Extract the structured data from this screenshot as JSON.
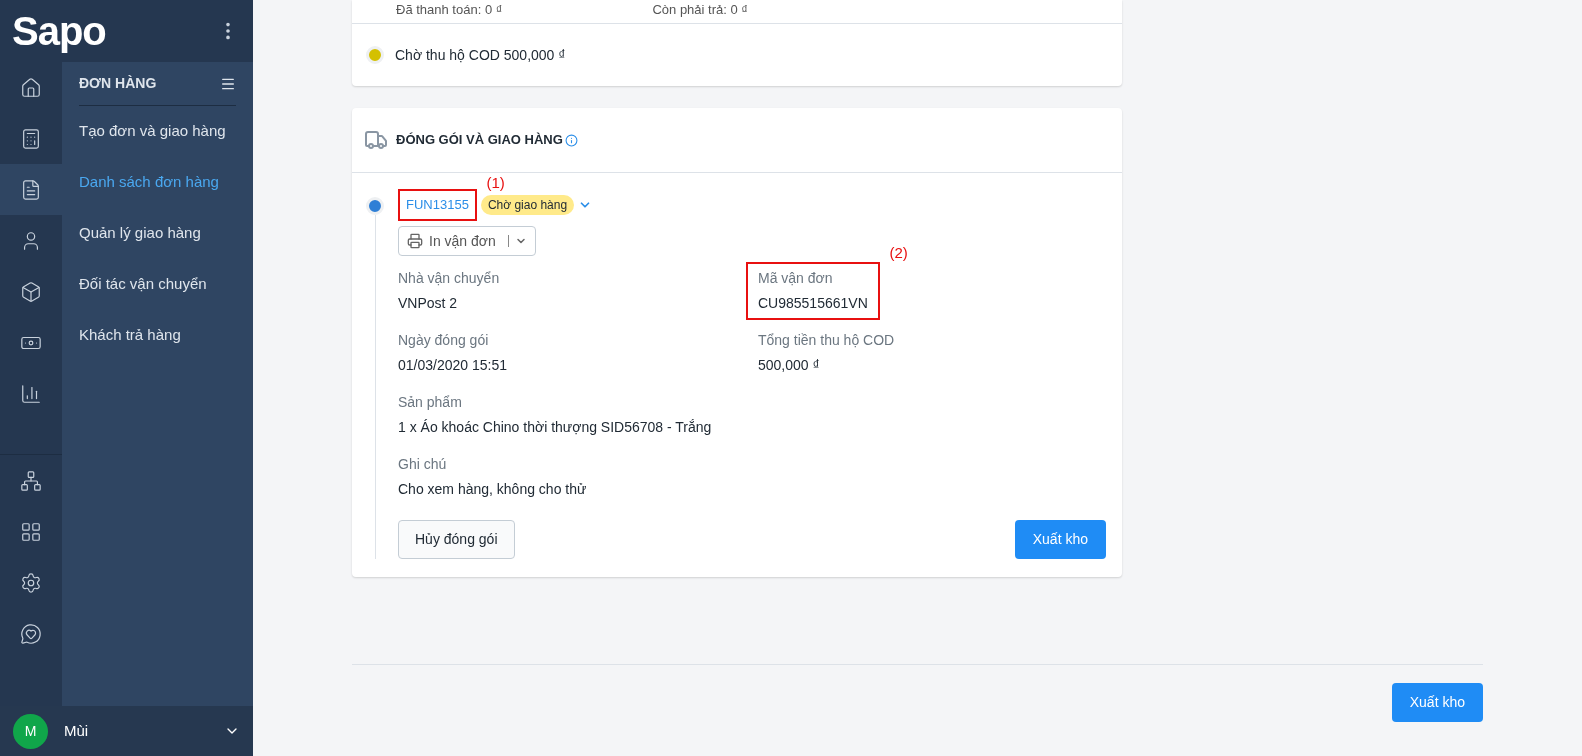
{
  "sidebar": {
    "logo": "Sapo",
    "rail": [
      {
        "kind": "home",
        "selected": false
      },
      {
        "kind": "register",
        "selected": false
      },
      {
        "kind": "orders",
        "selected": true
      },
      {
        "kind": "customer",
        "selected": false
      },
      {
        "kind": "product",
        "selected": false
      },
      {
        "kind": "cash",
        "selected": false
      },
      {
        "kind": "report",
        "selected": false
      }
    ],
    "rail_bottom": [
      {
        "kind": "network"
      },
      {
        "kind": "apps"
      },
      {
        "kind": "settings"
      },
      {
        "kind": "support"
      }
    ],
    "menu_title": "ĐƠN HÀNG",
    "menu_items": [
      {
        "label": "Tạo đơn và giao hàng",
        "selected": false
      },
      {
        "label": "Danh sách đơn hàng",
        "selected": true
      },
      {
        "label": "Quản lý giao hàng",
        "selected": false
      },
      {
        "label": "Đối tác vận chuyển",
        "selected": false
      },
      {
        "label": "Khách trả hàng",
        "selected": false
      }
    ],
    "user": {
      "initial": "M",
      "name": "Mùi"
    }
  },
  "payment": {
    "paid": "Đã thanh toán: 0 ₫",
    "remaining": "Còn phải trả: 0 ₫",
    "event": {
      "text": "Chờ thu hộ COD 500,000 ₫",
      "color": "#d4c000"
    }
  },
  "packing": {
    "title": "ĐÓNG GÓI VÀ GIAO HÀNG",
    "fulfillment": {
      "code": "FUN13155",
      "annotation": "(1)",
      "status": "Chờ giao hàng",
      "color": "#2f7fd6"
    },
    "print_button": "In vận đơn",
    "field_rows": [
      [
        {
          "label": "Nhà vận chuyển",
          "value": "VNPost 2"
        },
        {
          "label": "Mã vận đơn",
          "value": "CU985515661VN",
          "annotation": "(2)"
        }
      ],
      [
        {
          "label": "Ngày đóng gói",
          "value": "01/03/2020 15:51"
        },
        {
          "label": "Tổng tiền thu hộ COD",
          "value": "500,000 ₫"
        }
      ],
      [
        {
          "label": "Sản phẩm",
          "value": "1 x Áo khoác Chino thời thượng SID56708 - Trắng"
        }
      ],
      [
        {
          "label": "Ghi chú",
          "value": "Cho xem hàng, không cho thử"
        }
      ]
    ],
    "cancel_button": "Hủy đóng gói",
    "export_button": "Xuất kho"
  },
  "footer": {
    "export_button": "Xuất kho"
  }
}
